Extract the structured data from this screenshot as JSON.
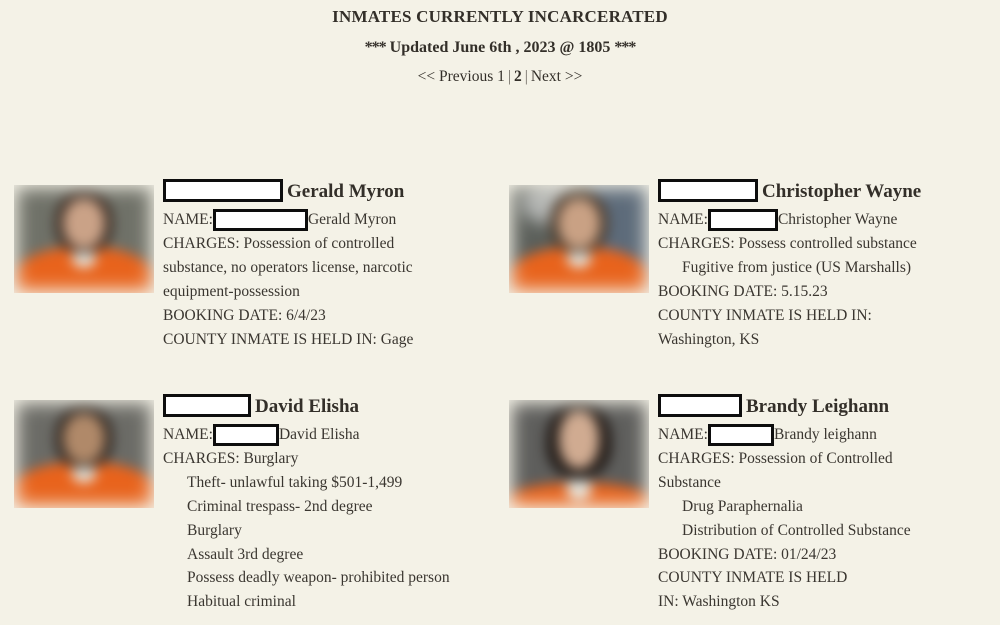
{
  "header": {
    "title": "INMATES CURRENTLY INCARCERATED",
    "updated_stars_left": "***",
    "updated_text": "Updated June 6th , 2023 @ 1805",
    "updated_stars_right": "***",
    "pager": {
      "previous_label": "<< Previous 1",
      "separator_1": "|",
      "page_2_label": "2",
      "separator_2": "|",
      "next_label": "Next >>"
    }
  },
  "labels": {
    "name": "NAME:",
    "charges": "CHARGES:",
    "booking_date": "BOOKING DATE:",
    "county_held": "COUNTY INMATE IS HELD IN:"
  },
  "colors": {
    "background": "#f4f2e7",
    "text": "#3a3630",
    "heading": "#332f29",
    "redaction_fill": "#ffffff",
    "redaction_border": "#0d0d0d",
    "jumpsuit_orange": "#e8631c"
  },
  "inmates": [
    {
      "heading_name": "Gerald Myron",
      "name_value": "Gerald Myron",
      "charges_first": "CHARGES: Possession of controlled",
      "charges_wrap_1": "substance, no operators license, narcotic",
      "charges_wrap_2": "equipment-possession",
      "extra_charges": [],
      "booking_line": "BOOKING DATE: 6/4/23",
      "county_line": "COUNTY INMATE IS HELD IN: Gage",
      "county_wrap": "",
      "photo": {
        "bg_base": "#6f7168",
        "bg_right": "#6f7168",
        "has_glow": false,
        "hair": "#3a2b22",
        "face": "#caa287",
        "torso_width": "wide"
      }
    },
    {
      "heading_name": "Christopher Wayne",
      "name_value": "Christopher Wayne",
      "charges_first": "CHARGES: Possess controlled substance",
      "charges_wrap_1": "",
      "charges_wrap_2": "",
      "extra_charges": [
        "Fugitive from justice (US Marshalls)"
      ],
      "booking_line": "BOOKING DATE: 5.15.23",
      "county_line": "COUNTY INMATE IS HELD IN:",
      "county_wrap": "Washington, KS",
      "photo": {
        "bg_base": "#5b5f5a",
        "bg_right": "#5d6b7a",
        "has_glow": true,
        "hair": "#4a3a2c",
        "face": "#c9a184",
        "torso_width": "wide"
      }
    },
    {
      "heading_name": "David Elisha",
      "name_value": "David Elisha",
      "charges_first": "CHARGES: Burglary",
      "charges_wrap_1": "",
      "charges_wrap_2": "",
      "extra_charges": [
        "Theft- unlawful taking $501-1,499",
        "Criminal trespass- 2nd degree",
        "Burglary",
        "Assault 3rd degree",
        "Possess deadly weapon- prohibited person",
        "Habitual criminal"
      ],
      "booking_line": "",
      "county_line": "",
      "county_wrap": "",
      "photo": {
        "bg_base": "#6b6b66",
        "bg_right": "#6b6b66",
        "has_glow": false,
        "hair": "#2f2620",
        "face": "#b08969",
        "torso_width": "wide"
      }
    },
    {
      "heading_name": "Brandy Leighann",
      "name_value": "Brandy leighann",
      "charges_first": "CHARGES: Possession of Controlled",
      "charges_wrap_1": "Substance",
      "charges_wrap_2": "",
      "extra_charges": [
        "Drug Paraphernalia",
        "Distribution of Controlled Substance"
      ],
      "booking_line": "BOOKING DATE: 01/24/23",
      "county_line": "COUNTY INMATE IS HELD",
      "county_wrap": "IN: Washington KS",
      "photo": {
        "bg_base": "#5e5e5c",
        "bg_right": "#5e5e5c",
        "has_glow": false,
        "hair": "#241d19",
        "face": "#d0ab91",
        "torso_width": "narrow"
      }
    }
  ]
}
